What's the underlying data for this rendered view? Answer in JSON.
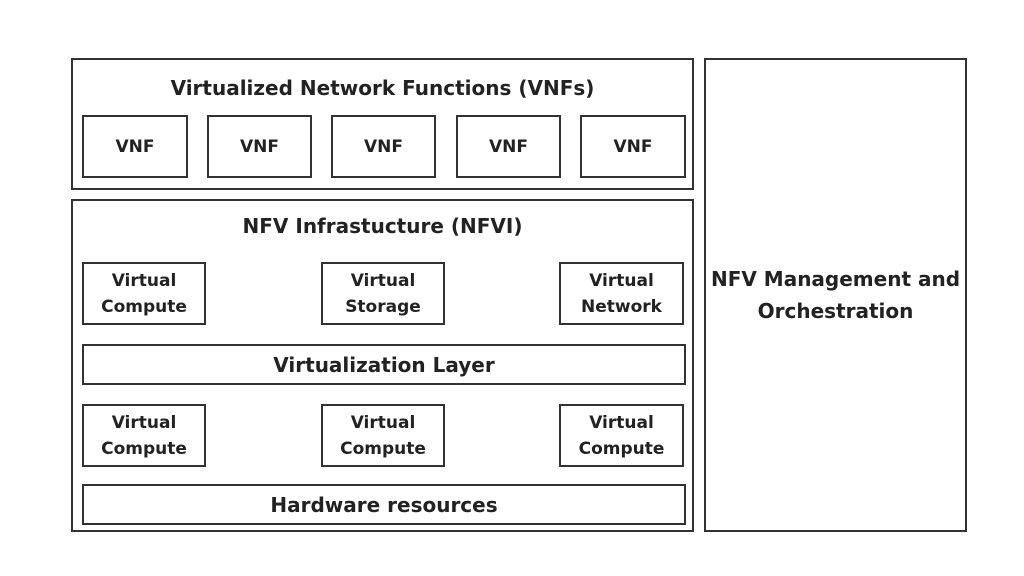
{
  "vnf_group": {
    "title": "Virtualized Network Functions (VNFs)",
    "items": [
      "VNF",
      "VNF",
      "VNF",
      "VNF",
      "VNF"
    ]
  },
  "nfvi": {
    "title": "NFV Infrastucture (NFVI)",
    "virtual_row": [
      [
        "Virtual",
        "Compute"
      ],
      [
        "Virtual",
        "Storage"
      ],
      [
        "Virtual",
        "Network"
      ]
    ],
    "virtualization_layer": "Virtualization Layer",
    "compute_row": [
      [
        "Virtual",
        "Compute"
      ],
      [
        "Virtual",
        "Compute"
      ],
      [
        "Virtual",
        "Compute"
      ]
    ],
    "hardware": "Hardware resources"
  },
  "mano": {
    "line1": "NFV Management and",
    "line2": "Orchestration"
  }
}
